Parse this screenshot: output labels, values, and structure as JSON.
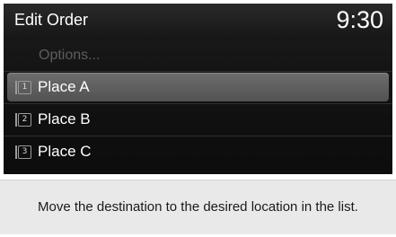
{
  "header": {
    "title": "Edit Order",
    "time": "9:30"
  },
  "menu": {
    "options_label": "Options...",
    "items": [
      {
        "number": "1",
        "label": "Place A",
        "selected": true
      },
      {
        "number": "2",
        "label": "Place B",
        "selected": false
      },
      {
        "number": "3",
        "label": "Place C",
        "selected": false
      }
    ]
  },
  "footer": {
    "hint": "Move the destination to the desired location in the list."
  },
  "colors": {
    "screen_bg": "#141414",
    "highlight": "#606060",
    "disabled_text": "#5d5d5d",
    "footer_bg": "#e9e9e9"
  }
}
